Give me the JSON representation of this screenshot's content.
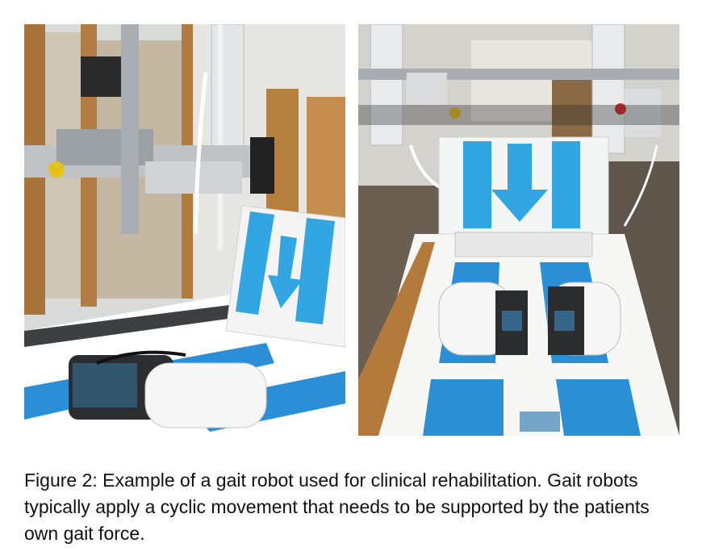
{
  "figure": {
    "caption": "Figure 2: Example of a gait robot used for clinical rehabilitation. Gait robots typically apply a cyclic movement that needs to be supported by the patients own gait force.",
    "photos": [
      {
        "depicts": "gait robot side view with foot plates and arrow sign"
      },
      {
        "depicts": "gait robot front view with foot plates and arrow sign"
      }
    ]
  }
}
